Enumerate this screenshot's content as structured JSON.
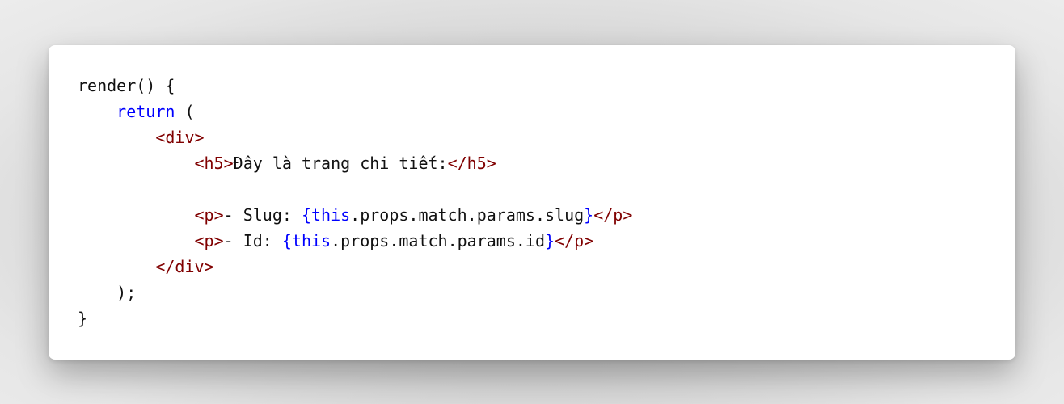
{
  "code": {
    "lines": [
      [
        {
          "t": "render() {",
          "c": "plain"
        }
      ],
      [
        {
          "t": "    ",
          "c": "plain"
        },
        {
          "t": "return",
          "c": "kw"
        },
        {
          "t": " (",
          "c": "plain"
        }
      ],
      [
        {
          "t": "        ",
          "c": "plain"
        },
        {
          "t": "<div>",
          "c": "tag"
        }
      ],
      [
        {
          "t": "            ",
          "c": "plain"
        },
        {
          "t": "<h5>",
          "c": "tag"
        },
        {
          "t": "Đây là trang chi tiết:",
          "c": "plain"
        },
        {
          "t": "</h5>",
          "c": "tag"
        }
      ],
      [
        {
          "t": "",
          "c": "plain"
        }
      ],
      [
        {
          "t": "            ",
          "c": "plain"
        },
        {
          "t": "<p>",
          "c": "tag"
        },
        {
          "t": "- Slug: ",
          "c": "plain"
        },
        {
          "t": "{",
          "c": "brace"
        },
        {
          "t": "this",
          "c": "kw"
        },
        {
          "t": ".props.match.params.slug",
          "c": "plain"
        },
        {
          "t": "}",
          "c": "brace"
        },
        {
          "t": "</p>",
          "c": "tag"
        }
      ],
      [
        {
          "t": "            ",
          "c": "plain"
        },
        {
          "t": "<p>",
          "c": "tag"
        },
        {
          "t": "- Id: ",
          "c": "plain"
        },
        {
          "t": "{",
          "c": "brace"
        },
        {
          "t": "this",
          "c": "kw"
        },
        {
          "t": ".props.match.params.id",
          "c": "plain"
        },
        {
          "t": "}",
          "c": "brace"
        },
        {
          "t": "</p>",
          "c": "tag"
        }
      ],
      [
        {
          "t": "        ",
          "c": "plain"
        },
        {
          "t": "</div>",
          "c": "tag"
        }
      ],
      [
        {
          "t": "    );",
          "c": "plain"
        }
      ],
      [
        {
          "t": "}",
          "c": "plain"
        }
      ]
    ]
  },
  "colors": {
    "plain": "#111111",
    "keyword": "#0000ff",
    "tag": "#800000",
    "brace": "#0000ff",
    "card_background": "#ffffff"
  }
}
